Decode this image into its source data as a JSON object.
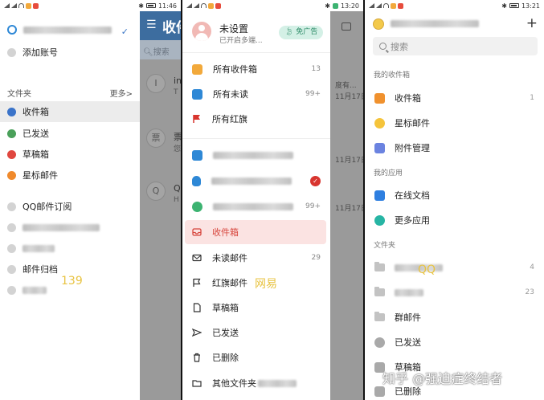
{
  "p1": {
    "status_time": "11:46",
    "add_account": "添加账号",
    "folders_label": "文件夹",
    "more_label": "更多>",
    "items": [
      {
        "label": "收件箱",
        "color": "#3a73c9"
      },
      {
        "label": "已发送",
        "color": "#4aa05a"
      },
      {
        "label": "草稿箱",
        "color": "#e0473f"
      },
      {
        "label": "星标邮件",
        "color": "#f08a2c"
      }
    ],
    "sub_items": [
      {
        "label": "QQ邮件订阅"
      },
      {
        "label": "邮件归档"
      }
    ],
    "watermark": "139",
    "overlay": {
      "title": "收件",
      "search_placeholder": "搜索",
      "rows": [
        {
          "avatar": "I",
          "line1": "in",
          "line2": "T"
        },
        {
          "avatar": "票",
          "line1": "票",
          "line2": "您"
        },
        {
          "avatar": "Q",
          "line1": "Q",
          "line2": "H"
        }
      ]
    }
  },
  "p2": {
    "status_time": "13:20",
    "user_name": "未设置",
    "user_sub": "已开启多端...",
    "badge": "免广告",
    "top_items": [
      {
        "label": "所有收件箱",
        "count": "13",
        "color": "#f2a93b"
      },
      {
        "label": "所有未读",
        "count": "99+",
        "color": "#2e88d6"
      },
      {
        "label": "所有红旗",
        "count": "",
        "color": "#d8352f"
      }
    ],
    "account_counts": [
      "",
      "",
      "99+"
    ],
    "items": [
      {
        "label": "收件箱",
        "count": ""
      },
      {
        "label": "未读邮件",
        "count": "29"
      },
      {
        "label": "红旗邮件",
        "count": ""
      },
      {
        "label": "草稿箱",
        "count": ""
      },
      {
        "label": "已发送",
        "count": ""
      },
      {
        "label": "已删除",
        "count": ""
      },
      {
        "label": "其他文件夹",
        "count": ""
      }
    ],
    "watermark": "网易",
    "overlay_texts": [
      "度有...",
      "11月17日",
      "11月17日",
      "11月17日"
    ]
  },
  "p3": {
    "status_time": "13:21",
    "search_placeholder": "搜索",
    "section_mine": "我的收件箱",
    "inbox_items": [
      {
        "label": "收件箱",
        "count": "1",
        "color": "#f0912e"
      },
      {
        "label": "星标邮件",
        "count": "",
        "color": "#f5c43b"
      },
      {
        "label": "附件管理",
        "count": "",
        "color": "#6b83e0"
      }
    ],
    "section_apps": "我的应用",
    "app_items": [
      {
        "label": "在线文档",
        "color": "#2e7fe0"
      },
      {
        "label": "更多应用",
        "color": "#27b5a4"
      }
    ],
    "section_folders": "文件夹",
    "folder_counts": [
      "4",
      "23"
    ],
    "folder_items": [
      {
        "label": "群邮件"
      },
      {
        "label": "已发送"
      },
      {
        "label": "草稿箱"
      },
      {
        "label": "已删除"
      }
    ],
    "watermark": "QQ",
    "zhihu_watermark": "知乎 @强迫症终结者"
  }
}
